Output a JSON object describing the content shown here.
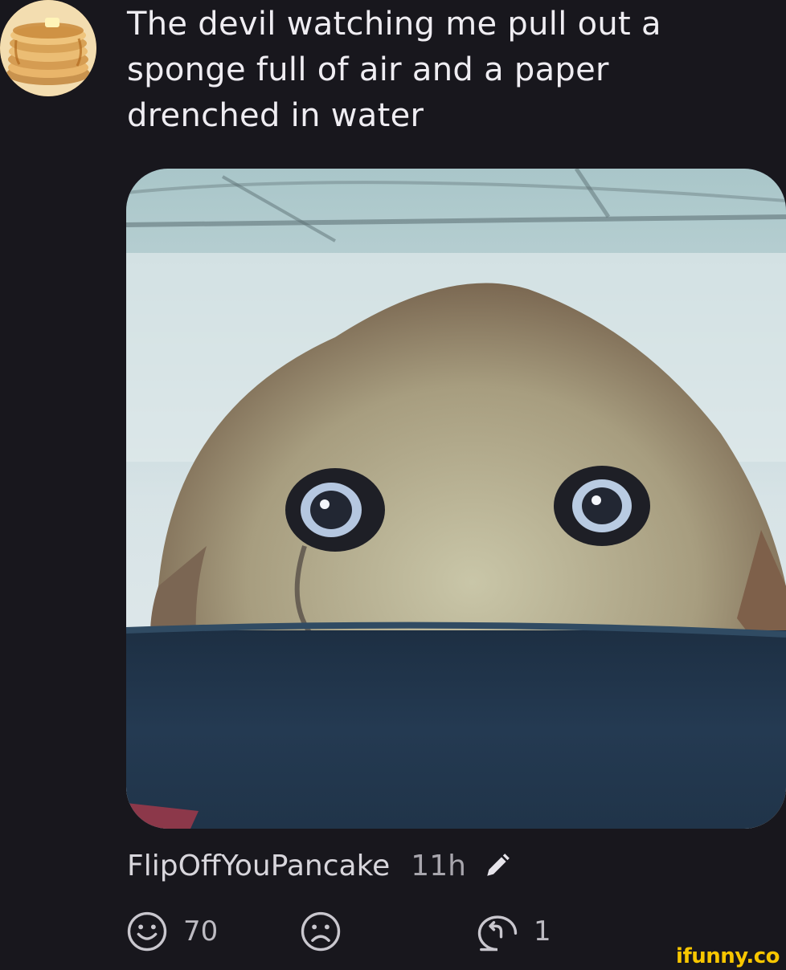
{
  "post": {
    "caption": "The devil watching me pull out a sponge full of air and a paper drenched in water",
    "username": "FlipOffYouPancake",
    "timestamp": "11h"
  },
  "actions": {
    "like_count": "70",
    "reply_count": "1"
  },
  "watermark": "ifunny.co",
  "icons": {
    "avatar": "pancake-stack-avatar",
    "edit": "pencil-icon",
    "like": "smile-face-icon",
    "dislike": "frown-face-icon",
    "reply": "reply-bubble-icon"
  },
  "colors": {
    "background": "#18171d",
    "text": "#eceaf0",
    "muted": "#bdbbc2",
    "watermark": "#f7c600"
  }
}
